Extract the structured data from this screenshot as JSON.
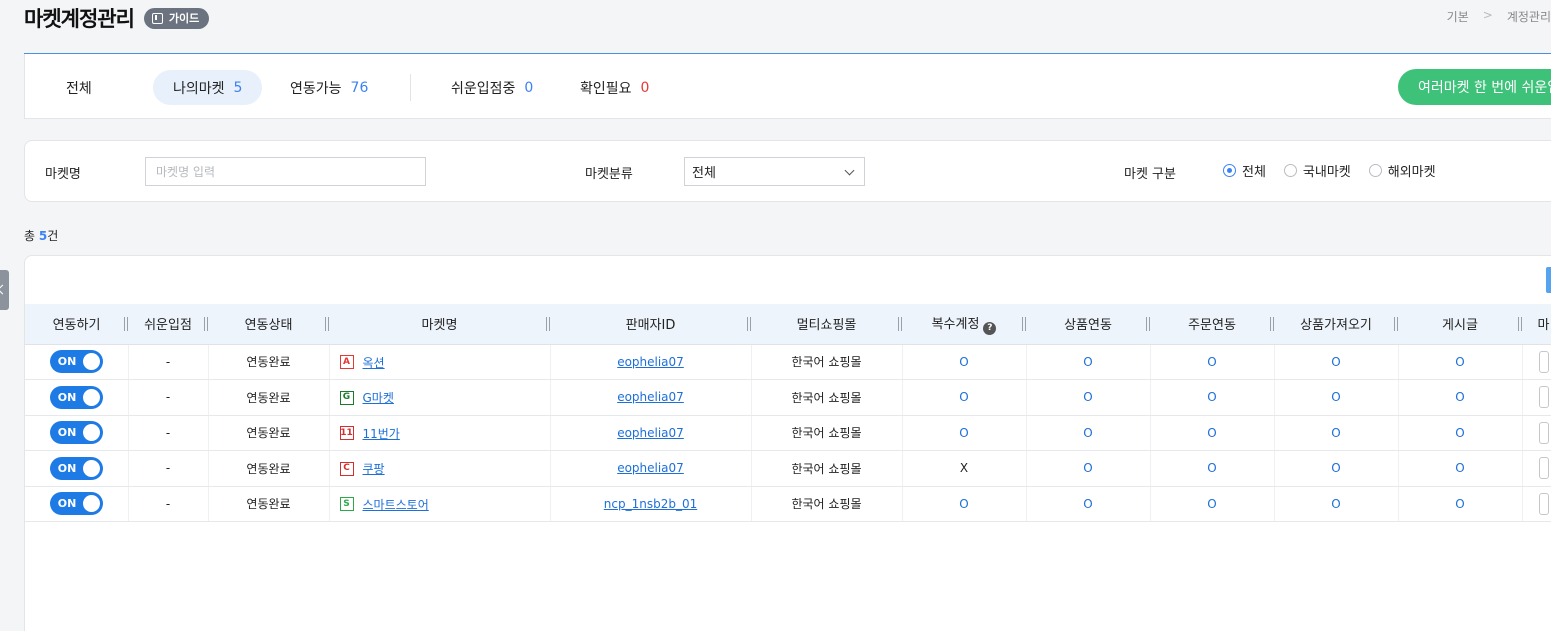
{
  "header": {
    "title": "마켓계정관리",
    "guide_label": "가이드",
    "breadcrumb": [
      "기본",
      "계정관리"
    ]
  },
  "tabs": [
    {
      "label": "전체",
      "count": ""
    },
    {
      "label": "나의마켓",
      "count": "5"
    },
    {
      "label": "연동가능",
      "count": "76"
    },
    {
      "label": "쉬운입점중",
      "count": "0"
    },
    {
      "label": "확인필요",
      "count": "0"
    }
  ],
  "cta_label": "여러마켓 한 번에 쉬운입점",
  "filters": {
    "market_name_label": "마켓명",
    "market_name_placeholder": "마켓명 입력",
    "category_label": "마켓분류",
    "category_value": "전체",
    "type_label": "마켓 구분",
    "type_options": [
      "전체",
      "국내마켓",
      "해외마켓"
    ]
  },
  "total": {
    "prefix": "총 ",
    "count": "5",
    "suffix": "건"
  },
  "table": {
    "columns": [
      "연동하기",
      "쉬운입점",
      "연동상태",
      "마켓명",
      "판매자ID",
      "멀티쇼핑몰",
      "복수계정",
      "상품연동",
      "주문연동",
      "상품가져오기",
      "게시글",
      "마"
    ],
    "rows": [
      {
        "toggle": "ON",
        "easy": "-",
        "status": "연동완료",
        "logo": "A",
        "market": "옥션",
        "seller": "eophelia07",
        "mall": "한국어 쇼핑몰",
        "multi": "O",
        "prod": "O",
        "order": "O",
        "import": "O",
        "post": "O"
      },
      {
        "toggle": "ON",
        "easy": "-",
        "status": "연동완료",
        "logo": "G",
        "market": "G마켓",
        "seller": "eophelia07",
        "mall": "한국어 쇼핑몰",
        "multi": "O",
        "prod": "O",
        "order": "O",
        "import": "O",
        "post": "O"
      },
      {
        "toggle": "ON",
        "easy": "-",
        "status": "연동완료",
        "logo": "11",
        "market": "11번가",
        "seller": "eophelia07",
        "mall": "한국어 쇼핑몰",
        "multi": "O",
        "prod": "O",
        "order": "O",
        "import": "O",
        "post": "O"
      },
      {
        "toggle": "ON",
        "easy": "-",
        "status": "연동완료",
        "logo": "C",
        "market": "쿠팡",
        "seller": "eophelia07",
        "mall": "한국어 쇼핑몰",
        "multi": "X",
        "prod": "O",
        "order": "O",
        "import": "O",
        "post": "O"
      },
      {
        "toggle": "ON",
        "easy": "-",
        "status": "연동완료",
        "logo": "S",
        "market": "스마트스토어",
        "seller": "ncp_1nsb2b_01",
        "mall": "한국어 쇼핑몰",
        "multi": "O",
        "prod": "O",
        "order": "O",
        "import": "O",
        "post": "O"
      }
    ]
  },
  "colors": {
    "accent": "#1e7be6",
    "cta": "#3ec27a",
    "warning": "#e53935",
    "header_bg": "#eef4fc"
  },
  "logo_colors": [
    "#e53935",
    "#1b7a2f",
    "#d32f2f",
    "#d32f2f",
    "#2ca84a"
  ]
}
